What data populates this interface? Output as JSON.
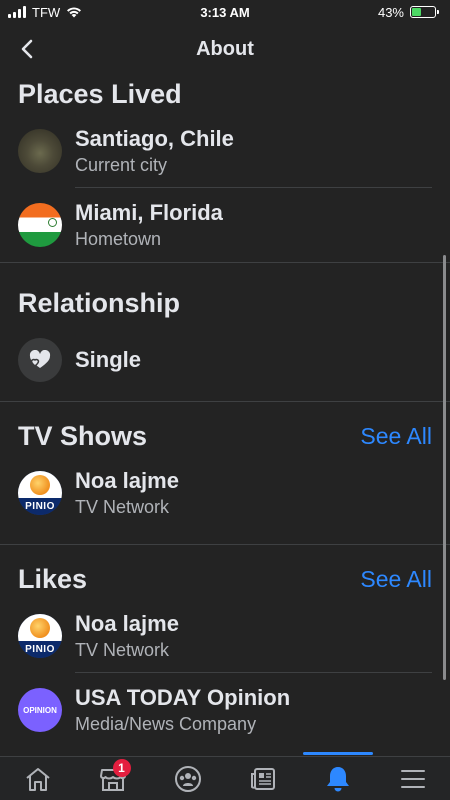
{
  "status": {
    "carrier": "TFW",
    "time": "3:13 AM",
    "battery": "43%",
    "battery_level": 0.43
  },
  "header": {
    "title": "About"
  },
  "sections": {
    "places": {
      "title": "Places Lived",
      "items": [
        {
          "name": "Santiago, Chile",
          "sub": "Current city"
        },
        {
          "name": "Miami, Florida",
          "sub": "Hometown"
        }
      ]
    },
    "relationship": {
      "title": "Relationship",
      "items": [
        {
          "name": "Single"
        }
      ]
    },
    "tv": {
      "title": "TV Shows",
      "see_all": "See All",
      "items": [
        {
          "name": "Noa lajme",
          "sub": "TV Network",
          "logo_text": "PINIO"
        }
      ]
    },
    "likes": {
      "title": "Likes",
      "see_all": "See All",
      "items": [
        {
          "name": "Noa lajme",
          "sub": "TV Network",
          "logo_text": "PINIO"
        },
        {
          "name": "USA TODAY Opinion",
          "sub": "Media/News Company",
          "logo_text": "OPINION"
        }
      ]
    }
  },
  "tabbar": {
    "tabs": [
      "home-icon",
      "marketplace-icon",
      "groups-icon",
      "news-icon",
      "notifications-icon",
      "menu-icon"
    ],
    "marketplace_badge": "1",
    "active_color": "#2d88ff"
  }
}
